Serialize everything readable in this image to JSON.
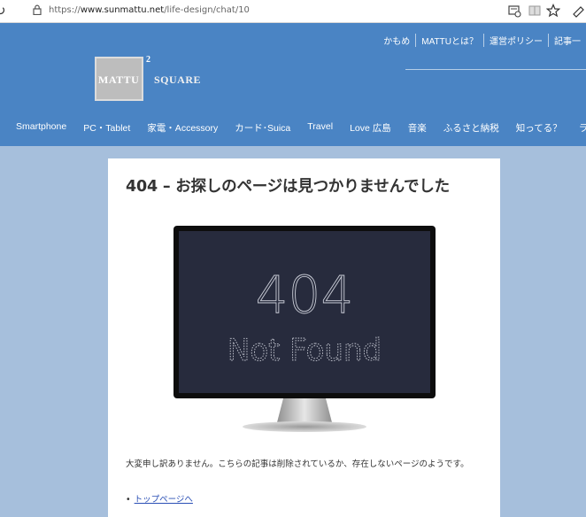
{
  "browser": {
    "reload_icon": "reload-icon",
    "url_prefix": "https://",
    "url_host": "www.sunmattu.net",
    "url_path": "/life-design/chat/10"
  },
  "header": {
    "top_nav": [
      "かもめ",
      "MATTUとは？",
      "運営ポリシー",
      "記事一"
    ],
    "logo": {
      "text": "MATTU",
      "superscript": "2",
      "square": "SQUARE"
    },
    "main_nav": [
      "Smartphone",
      "PC・Tablet",
      "家電・Accessory",
      "カード･Suica",
      "Travel",
      "Love 広島",
      "音楽",
      "ふるさと納税",
      "知ってる？",
      "ラジオ"
    ]
  },
  "main": {
    "title": "404 – お探しのページは見つかりませんでした",
    "image": {
      "line1": "404",
      "line2": "Not Found"
    },
    "message": "大変申し訳ありません。こちらの記事は削除されているか、存在しないページのようです。",
    "bullet": "•",
    "link": "トップページへ"
  },
  "colors": {
    "header_bg": "#4a84c4",
    "page_bg": "#a6bfdc",
    "screen_bg": "#272b3d",
    "link": "#2a4fb5"
  }
}
